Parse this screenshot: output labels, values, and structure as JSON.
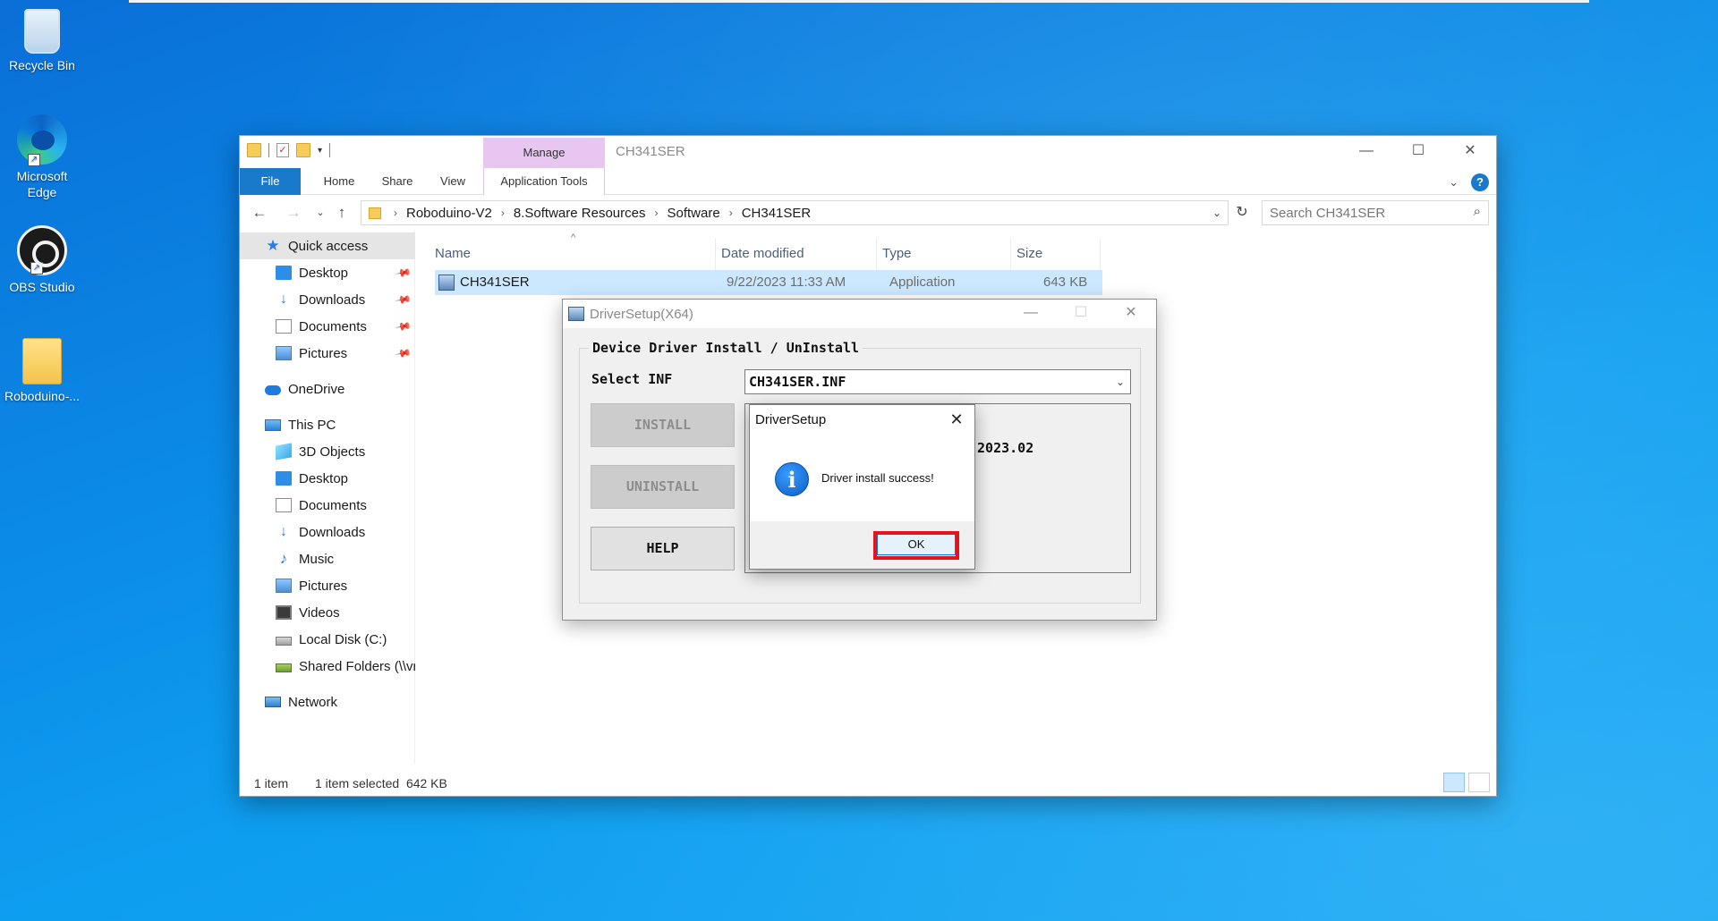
{
  "desktop": {
    "icons": [
      {
        "label": "Recycle Bin"
      },
      {
        "label": "Microsoft Edge"
      },
      {
        "label": "OBS Studio"
      },
      {
        "label": "Roboduino-..."
      }
    ]
  },
  "explorer": {
    "title": "CH341SER",
    "manage_tab": "Manage",
    "ribbon_tabs": [
      "File",
      "Home",
      "Share",
      "View",
      "Application Tools"
    ],
    "breadcrumb": [
      "Roboduino-V2",
      "8.Software Resources",
      "Software",
      "CH341SER"
    ],
    "search_placeholder": "Search CH341SER",
    "nav": {
      "quick_access": "Quick access",
      "quick_items": [
        "Desktop",
        "Downloads",
        "Documents",
        "Pictures"
      ],
      "onedrive": "OneDrive",
      "this_pc": "This PC",
      "pc_items": [
        "3D Objects",
        "Desktop",
        "Documents",
        "Downloads",
        "Music",
        "Pictures",
        "Videos",
        "Local Disk (C:)",
        "Shared Folders (\\\\vr"
      ],
      "network": "Network"
    },
    "columns": {
      "name": "Name",
      "date": "Date modified",
      "type": "Type",
      "size": "Size"
    },
    "files": [
      {
        "name": "CH341SER",
        "date": "9/22/2023 11:33 AM",
        "type": "Application",
        "size": "643 KB"
      }
    ],
    "status": {
      "count": "1 item",
      "selected": "1 item selected  642 KB"
    }
  },
  "driver_setup": {
    "title": "DriverSetup(X64)",
    "group_label": "Device Driver Install / UnInstall",
    "select_label": "Select INF",
    "select_value": "CH341SER.INF",
    "install_label": "INSTALL",
    "uninstall_label": "UNINSTALL",
    "help_label": "HELP",
    "version_text": ".2023.02"
  },
  "message_box": {
    "title": "DriverSetup",
    "text": "Driver install success!",
    "ok_label": "OK"
  }
}
